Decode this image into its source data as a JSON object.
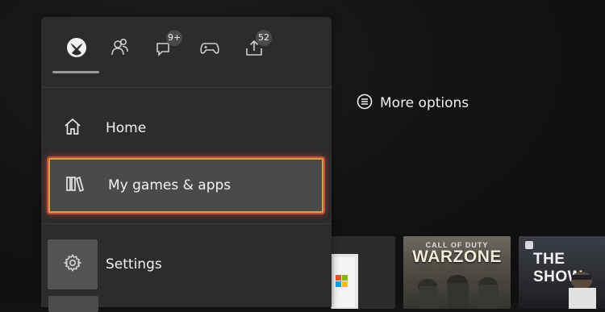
{
  "tabs": [
    {
      "icon": "xbox-logo-icon"
    },
    {
      "icon": "people-icon"
    },
    {
      "icon": "messages-icon",
      "badge": "9+"
    },
    {
      "icon": "controller-icon"
    },
    {
      "icon": "upload-icon",
      "badge": "52"
    }
  ],
  "menu": {
    "home_label": "Home",
    "games_label": "My games & apps",
    "settings_label": "Settings"
  },
  "more_options_label": "More options",
  "tiles": {
    "warzone_small": "CALL OF DUTY",
    "warzone_title": "WARZONE",
    "show_title": "THE SHOW"
  },
  "colors": {
    "panel_bg": "#2c2c2c",
    "selected_bg": "#4a4a4a",
    "focus_outer": "#c44a3a",
    "focus_inner": "#d2a33f"
  }
}
